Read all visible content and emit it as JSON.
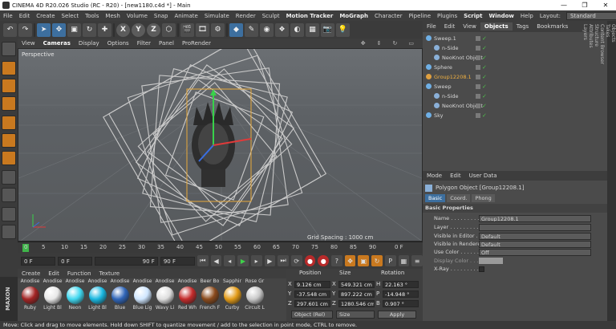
{
  "window": {
    "title": "CINEMA 4D R20.026 Studio (RC - R20) - [new1180.c4d *] - Main"
  },
  "menu": {
    "items": [
      "File",
      "Edit",
      "Create",
      "Select",
      "Tools",
      "Mesh",
      "Volume",
      "Snap",
      "Animate",
      "Simulate",
      "Render",
      "Sculpt",
      "Motion Tracker",
      "MoGraph",
      "Character",
      "Pipeline",
      "Plugins",
      "Script",
      "Window",
      "Help"
    ],
    "layout_label": "Layout:",
    "layout_value": "Standard"
  },
  "toolbar": {
    "axis_x": "X",
    "axis_y": "Y",
    "axis_z": "Z"
  },
  "viewport": {
    "menu": [
      "View",
      "Cameras",
      "Display",
      "Options",
      "Filter",
      "Panel",
      "ProRender"
    ],
    "label": "Perspective",
    "grid_spacing": "Grid Spacing : 1000 cm"
  },
  "timeline": {
    "ticks": [
      "0",
      "5",
      "10",
      "15",
      "20",
      "25",
      "30",
      "35",
      "40",
      "45",
      "50",
      "55",
      "60",
      "65",
      "70",
      "75",
      "80",
      "85",
      "90"
    ],
    "end_frame": "0 F",
    "start_field": "0 F",
    "current_field": "0 F",
    "end_field": "90 F",
    "max_field": "90 F"
  },
  "materials": {
    "menu": [
      "Create",
      "Edit",
      "Function",
      "Texture"
    ],
    "items": [
      {
        "top": "Anodise",
        "label": "Ruby",
        "color": "#a32424"
      },
      {
        "top": "Anodise",
        "label": "Light Bl",
        "color": "#e8e8e8"
      },
      {
        "top": "Anodise",
        "label": "Neon",
        "color": "#3fd7ef"
      },
      {
        "top": "Anodise",
        "label": "Light Bl",
        "color": "#19b7e0"
      },
      {
        "top": "Anodise",
        "label": "Blue",
        "color": "#2f65b8"
      },
      {
        "top": "Anodise",
        "label": "Blue Lig",
        "color": "#cfe6ff"
      },
      {
        "top": "Anodise",
        "label": "Wavy Li",
        "color": "#dedede"
      },
      {
        "top": "Anodise",
        "label": "Red Wh",
        "color": "#c42b2b"
      },
      {
        "top": "Beer Bo",
        "label": "French F",
        "color": "#8a4a1c"
      },
      {
        "top": "Sapphir",
        "label": "Curby",
        "color": "#e39b17"
      },
      {
        "top": "Rose Gr",
        "label": "Circuit L",
        "color": "#c9c9c9"
      }
    ],
    "brand": "MAXON CINEMA 4D"
  },
  "coordinates": {
    "headers": [
      "Position",
      "Size",
      "Rotation"
    ],
    "rows": [
      {
        "axis": "X",
        "pos": "9.126 cm",
        "size_axis": "X",
        "size": "549.321 cm",
        "rot_axis": "H",
        "rot": "22.163 °"
      },
      {
        "axis": "Y",
        "pos": "-37.548 cm",
        "size_axis": "Y",
        "size": "897.222 cm",
        "rot_axis": "P",
        "rot": "-14.948 °"
      },
      {
        "axis": "Z",
        "pos": "297.601 cm",
        "size_axis": "Z",
        "size": "1280.546 cm",
        "rot_axis": "B",
        "rot": "0.907 °"
      }
    ],
    "mode": "Object (Rel)",
    "size_mode": "Size",
    "apply": "Apply"
  },
  "objects": {
    "menu": [
      "File",
      "Edit",
      "View",
      "Objects",
      "Tags",
      "Bookmarks"
    ],
    "active_tab": "Objects",
    "items": [
      {
        "name": "Sweep.1",
        "indent": 0,
        "color": "#6fb0e6"
      },
      {
        "name": "n-Side",
        "indent": 1,
        "color": "#8ab0d8"
      },
      {
        "name": "NeoKnot Object",
        "indent": 1,
        "color": "#8ab0d8"
      },
      {
        "name": "Sphere",
        "indent": 0,
        "color": "#6fb0e6"
      },
      {
        "name": "Group12208.1",
        "indent": 0,
        "color": "#e0a040",
        "highlight": true
      },
      {
        "name": "Sweep",
        "indent": 0,
        "color": "#6fb0e6"
      },
      {
        "name": "n-Side",
        "indent": 1,
        "color": "#8ab0d8"
      },
      {
        "name": "NeoKnot Object",
        "indent": 1,
        "color": "#8ab0d8"
      },
      {
        "name": "Sky",
        "indent": 0,
        "color": "#6fb0e6"
      }
    ]
  },
  "attributes": {
    "menu": [
      "Mode",
      "Edit",
      "User Data"
    ],
    "title": "Polygon Object [Group12208.1]",
    "tabs": [
      "Basic",
      "Coord.",
      "Phong"
    ],
    "section": "Basic Properties",
    "rows": [
      {
        "label": "Name . . . . . . . . . . . .",
        "value": "Group12208.1"
      },
      {
        "label": "Layer . . . . . . . . . . . .",
        "value": ""
      },
      {
        "label": "Visible in Editor . .",
        "value": "Default"
      },
      {
        "label": "Visible in Renderer",
        "value": "Default"
      },
      {
        "label": "Use Color . . . . . . .",
        "value": "Off"
      },
      {
        "label": "Display Color . . . .",
        "value": ""
      },
      {
        "label": "X-Ray . . . . . . . . . . .",
        "value": ""
      }
    ]
  },
  "sidetabs": [
    "Objects",
    "Takes",
    "Content Browser",
    "Structure",
    "Attributes",
    "Layers"
  ],
  "status": "Move: Click and drag to move elements. Hold down SHIFT to quantize movement / add to the selection in point mode, CTRL to remove."
}
